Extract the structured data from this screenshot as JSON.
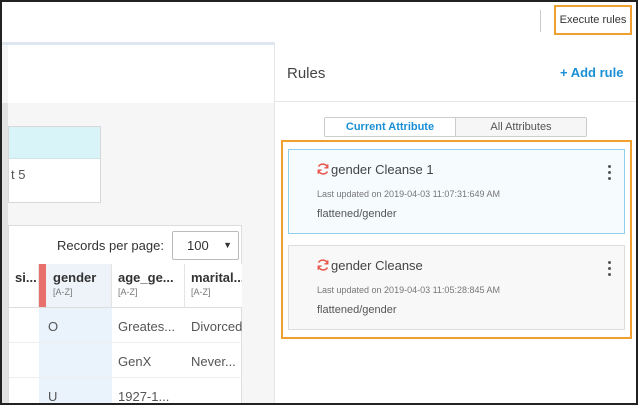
{
  "toolbar": {
    "execute_label": "Execute rules"
  },
  "left": {
    "card_text": "t 5",
    "records_per_page_label": "Records per page:",
    "records_per_page_value": "100",
    "columns": [
      {
        "name": "si...",
        "sort": ""
      },
      {
        "name": "gender",
        "sort": "[A-Z]"
      },
      {
        "name": "age_ge...",
        "sort": "[A-Z]"
      },
      {
        "name": "marital...",
        "sort": "[A-Z]"
      }
    ],
    "rows": [
      [
        "",
        "O",
        "Greates...",
        "Divorced"
      ],
      [
        "",
        "",
        "GenX",
        "Never..."
      ],
      [
        "",
        "U",
        "1927-1...",
        ""
      ]
    ]
  },
  "rules_panel": {
    "title": "Rules",
    "add_rule_label": "+ Add rule",
    "tabs": [
      {
        "label": "Current Attribute",
        "active": true
      },
      {
        "label": "All Attributes",
        "active": false
      }
    ],
    "rules": [
      {
        "name": "gender Cleanse 1",
        "updated": "Last updated on 2019-04-03 11:07:31:649 AM",
        "path": "flattened/gender",
        "selected": true
      },
      {
        "name": "gender Cleanse",
        "updated": "Last updated on 2019-04-03 11:05:28:845 AM",
        "path": "flattened/gender",
        "selected": false
      }
    ]
  },
  "colors": {
    "accent": "#1a8fd6",
    "highlight_outline": "#f0a030",
    "gender_marker": "#e8706c",
    "sync_icon": "#e8544a"
  }
}
